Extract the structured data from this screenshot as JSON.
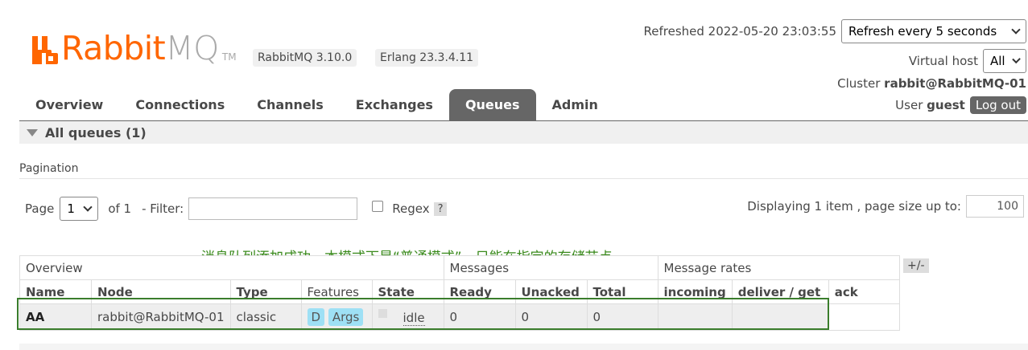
{
  "brand": {
    "name_a": "Rabbit",
    "name_b": "MQ",
    "tm": "TM",
    "color": "#ff6600"
  },
  "versions": {
    "rabbitmq": "RabbitMQ 3.10.0",
    "erlang": "Erlang 23.3.4.11"
  },
  "status": {
    "refreshed_label": "Refreshed 2022-05-20 23:03:55",
    "refresh_select": "Refresh every 5 seconds",
    "vhost_label": "Virtual host",
    "vhost_select": "All",
    "cluster_label": "Cluster",
    "cluster_name": "rabbit@RabbitMQ-01",
    "user_label": "User",
    "user_name": "guest",
    "logout": "Log out"
  },
  "nav": {
    "tabs": [
      "Overview",
      "Connections",
      "Channels",
      "Exchanges",
      "Queues",
      "Admin"
    ],
    "active": "Queues"
  },
  "section": {
    "title": "All queues (1)"
  },
  "pagination": {
    "title": "Pagination",
    "page_label": "Page",
    "page_value": "1",
    "of_label": "of 1",
    "filter_label": "- Filter:",
    "filter_value": "",
    "regex_label": "Regex",
    "help": "?",
    "display_label": "Displaying 1 item , page size up to:",
    "page_size": "100"
  },
  "annotation": "消息队列添加成功，本模式下是“普通模式”，只能在指定的存储节点",
  "table": {
    "groups": {
      "overview": "Overview",
      "messages": "Messages",
      "rates": "Message rates"
    },
    "headers": [
      "Name",
      "Node",
      "Type",
      "Features",
      "State",
      "Ready",
      "Unacked",
      "Total",
      "incoming",
      "deliver / get",
      "ack"
    ],
    "plusminus": "+/-",
    "rows": [
      {
        "name": "AA",
        "node": "rabbit@RabbitMQ-01",
        "type": "classic",
        "feature_d": "D",
        "feature_args": "Args",
        "state": "idle",
        "ready": "0",
        "unacked": "0",
        "total": "0",
        "incoming": "",
        "deliver": "",
        "ack": ""
      }
    ]
  }
}
